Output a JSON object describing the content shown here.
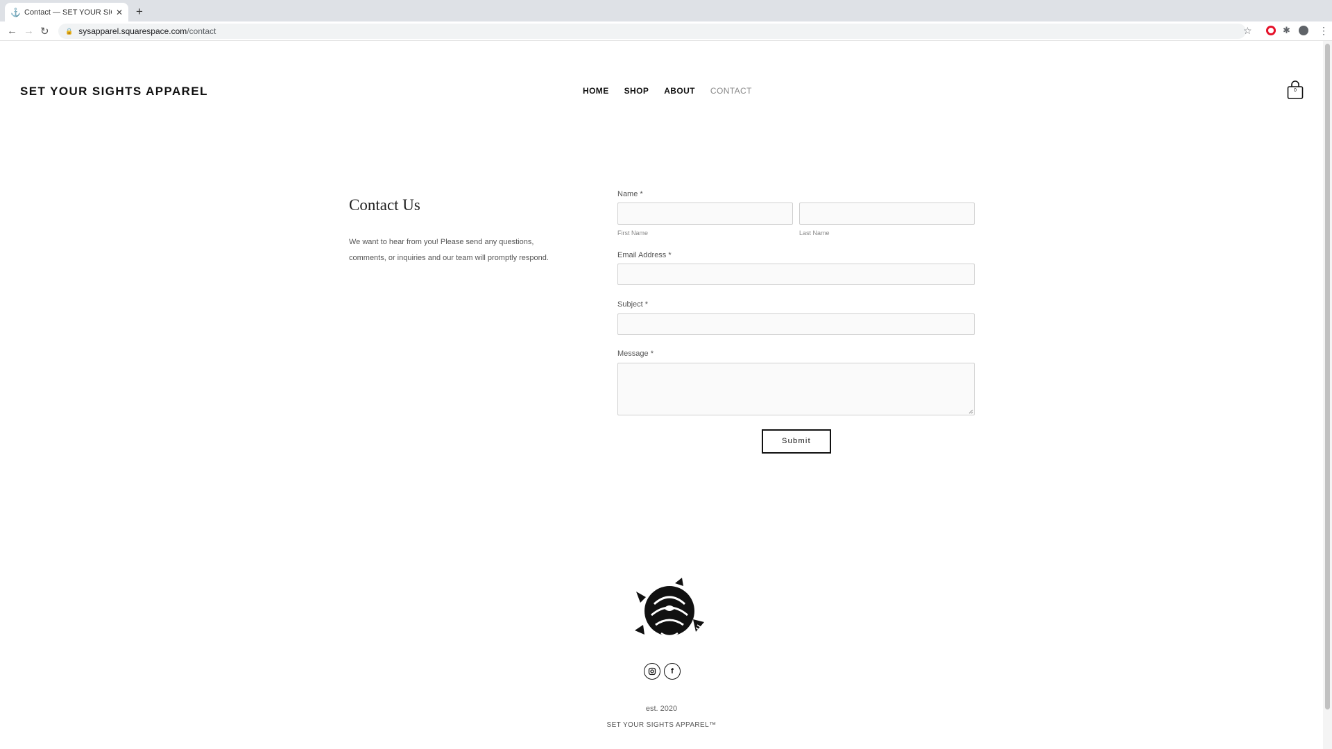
{
  "browser": {
    "tab_title": "Contact — SET YOUR SIGHTS",
    "new_tab_label": "+",
    "close_label": "✕",
    "url_domain": "sysapparel.squarespace.com",
    "url_path": "/contact"
  },
  "header": {
    "brand": "SET YOUR SIGHTS APPAREL",
    "nav": [
      "HOME",
      "SHOP",
      "ABOUT",
      "CONTACT"
    ],
    "active_nav": "CONTACT",
    "cart_count": "0"
  },
  "intro": {
    "title": "Contact Us",
    "description": "We want to hear from you! Please send any questions, comments, or inquiries and our team will promptly respond."
  },
  "form": {
    "name_label": "Name",
    "required_mark": "*",
    "first_name_sub": "First Name",
    "last_name_sub": "Last Name",
    "email_label": "Email Address",
    "subject_label": "Subject",
    "message_label": "Message",
    "submit_label": "Submit"
  },
  "footer": {
    "established": "est. 2020",
    "brand": "SET YOUR SIGHTS APPAREL™",
    "social": [
      "instagram-icon",
      "facebook-icon"
    ]
  },
  "colors": {
    "accent_active_nav": "#888888",
    "input_background": "#fafafa",
    "input_border": "#cfcfcf",
    "opera_red": "#e5122a"
  }
}
